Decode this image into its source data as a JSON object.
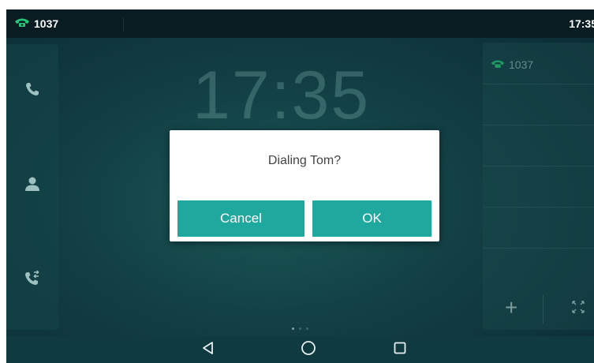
{
  "status_bar": {
    "account": "1037",
    "time": "17:35"
  },
  "clock": {
    "time": "17:35"
  },
  "left_rail": {
    "items": [
      {
        "icon": "phone-icon"
      },
      {
        "icon": "contact-icon"
      },
      {
        "icon": "call-history-icon"
      }
    ]
  },
  "right_panel": {
    "account": "1037",
    "add_icon": "plus-icon",
    "expand_icon": "expand-icon"
  },
  "dialog": {
    "message": "Dialing Tom?",
    "cancel_label": "Cancel",
    "ok_label": "OK"
  },
  "pagination": {
    "pages": 3,
    "current": 1
  },
  "navbar": {
    "buttons": [
      "back-icon",
      "home-icon",
      "recents-icon"
    ]
  },
  "colors": {
    "accent": "#1fa89d",
    "status_icon": "#26c47a",
    "status_bar": "#081c22",
    "background": "#123f44"
  }
}
